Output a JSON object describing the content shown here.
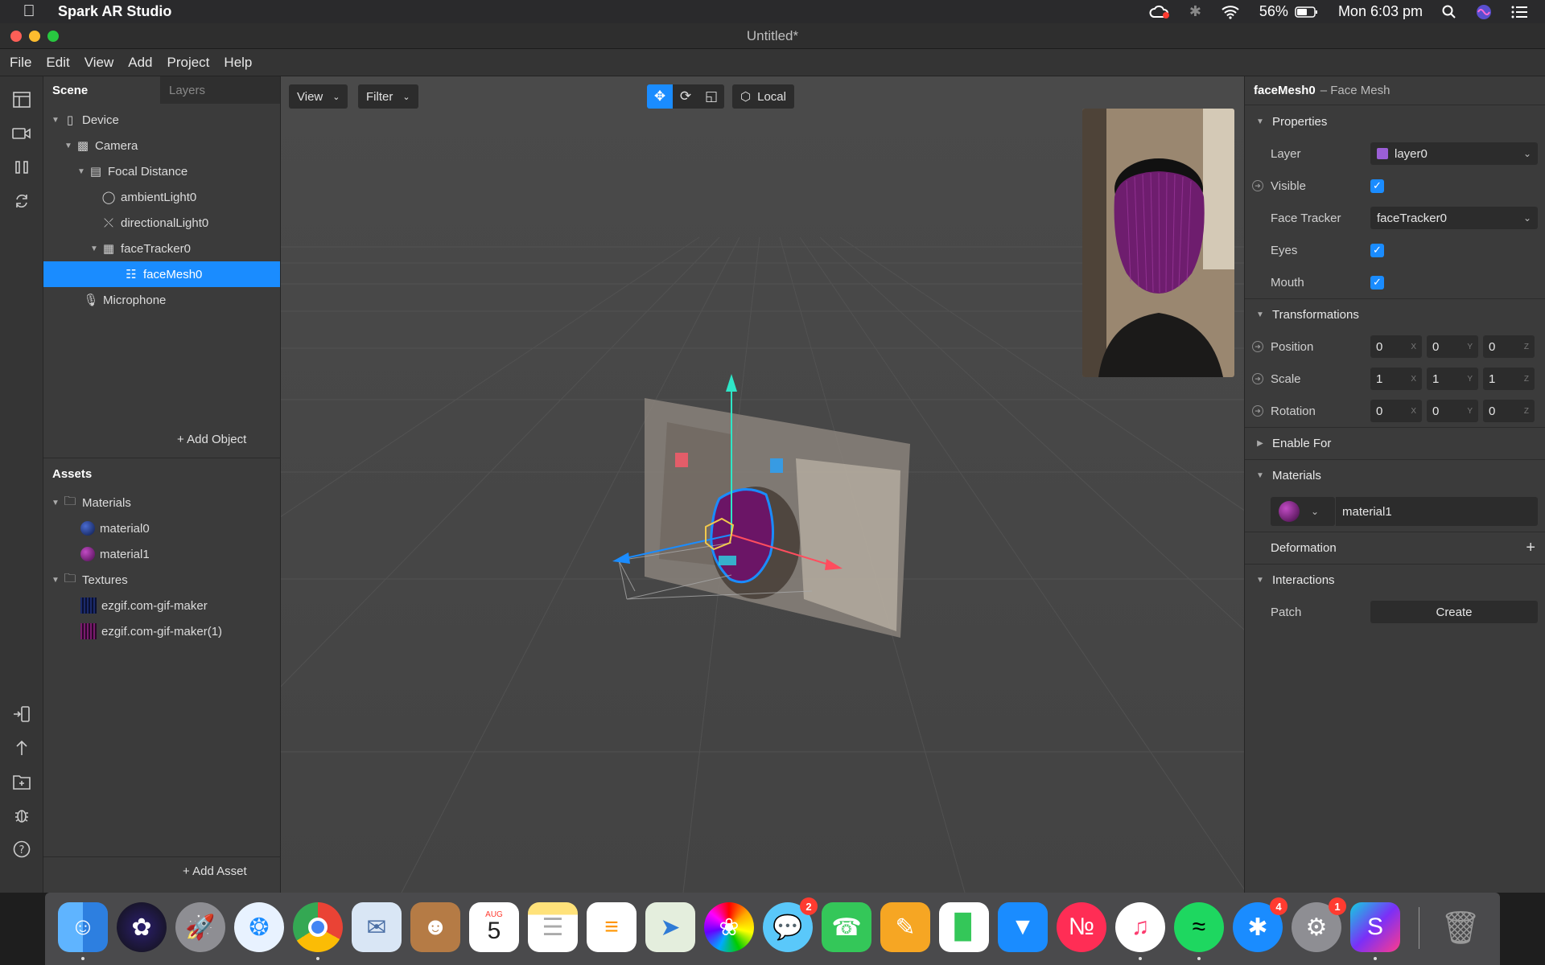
{
  "menubar": {
    "app_name": "Spark AR Studio",
    "battery": "56%",
    "clock": "Mon 6:03 pm"
  },
  "window": {
    "title": "Untitled*"
  },
  "app_menu": [
    "File",
    "Edit",
    "View",
    "Add",
    "Project",
    "Help"
  ],
  "scene_panel": {
    "tabs": [
      "Scene",
      "Layers"
    ],
    "tree": [
      {
        "label": "Device",
        "icon": "phone-icon"
      },
      {
        "label": "Camera",
        "icon": "camera-icon"
      },
      {
        "label": "Focal Distance",
        "icon": "ruler-icon"
      },
      {
        "label": "ambientLight0",
        "icon": "globe-icon"
      },
      {
        "label": "directionalLight0",
        "icon": "directional-light-icon"
      },
      {
        "label": "faceTracker0",
        "icon": "face-tracker-icon"
      },
      {
        "label": "faceMesh0",
        "icon": "mesh-icon"
      },
      {
        "label": "Microphone",
        "icon": "microphone-icon"
      }
    ],
    "add_object": "Add Object",
    "assets_title": "Assets",
    "assets": [
      {
        "label": "Materials",
        "icon": "folder-icon"
      },
      {
        "label": "material0",
        "icon": "material-sphere-icon"
      },
      {
        "label": "material1",
        "icon": "material-sphere-icon"
      },
      {
        "label": "Textures",
        "icon": "folder-icon"
      },
      {
        "label": "ezgif.com-gif-maker",
        "icon": "texture-icon"
      },
      {
        "label": "ezgif.com-gif-maker(1)",
        "icon": "texture-icon"
      }
    ],
    "add_asset": "Add Asset"
  },
  "viewport": {
    "view_label": "View",
    "filter_label": "Filter",
    "local_label": "Local"
  },
  "inspector": {
    "object_name": "faceMesh0",
    "object_type": "– Face Mesh",
    "sections": {
      "properties": "Properties",
      "transformations": "Transformations",
      "enable_for": "Enable For",
      "materials": "Materials",
      "deformation": "Deformation",
      "interactions": "Interactions"
    },
    "layer_label": "Layer",
    "layer_value": "layer0",
    "visible_label": "Visible",
    "face_tracker_label": "Face Tracker",
    "face_tracker_value": "faceTracker0",
    "eyes_label": "Eyes",
    "mouth_label": "Mouth",
    "position_label": "Position",
    "position": [
      "0",
      "0",
      "0"
    ],
    "scale_label": "Scale",
    "scale": [
      "1",
      "1",
      "1"
    ],
    "rotation_label": "Rotation",
    "rotation": [
      "0",
      "0",
      "0"
    ],
    "axes": [
      "X",
      "Y",
      "Z"
    ],
    "material_value": "material1",
    "patch_label": "Patch",
    "create_label": "Create"
  },
  "dock": {
    "badges": {
      "messages": "2",
      "app_store": "4",
      "system_prefs": "1"
    },
    "calendar_month": "AUG",
    "calendar_day": "5"
  }
}
